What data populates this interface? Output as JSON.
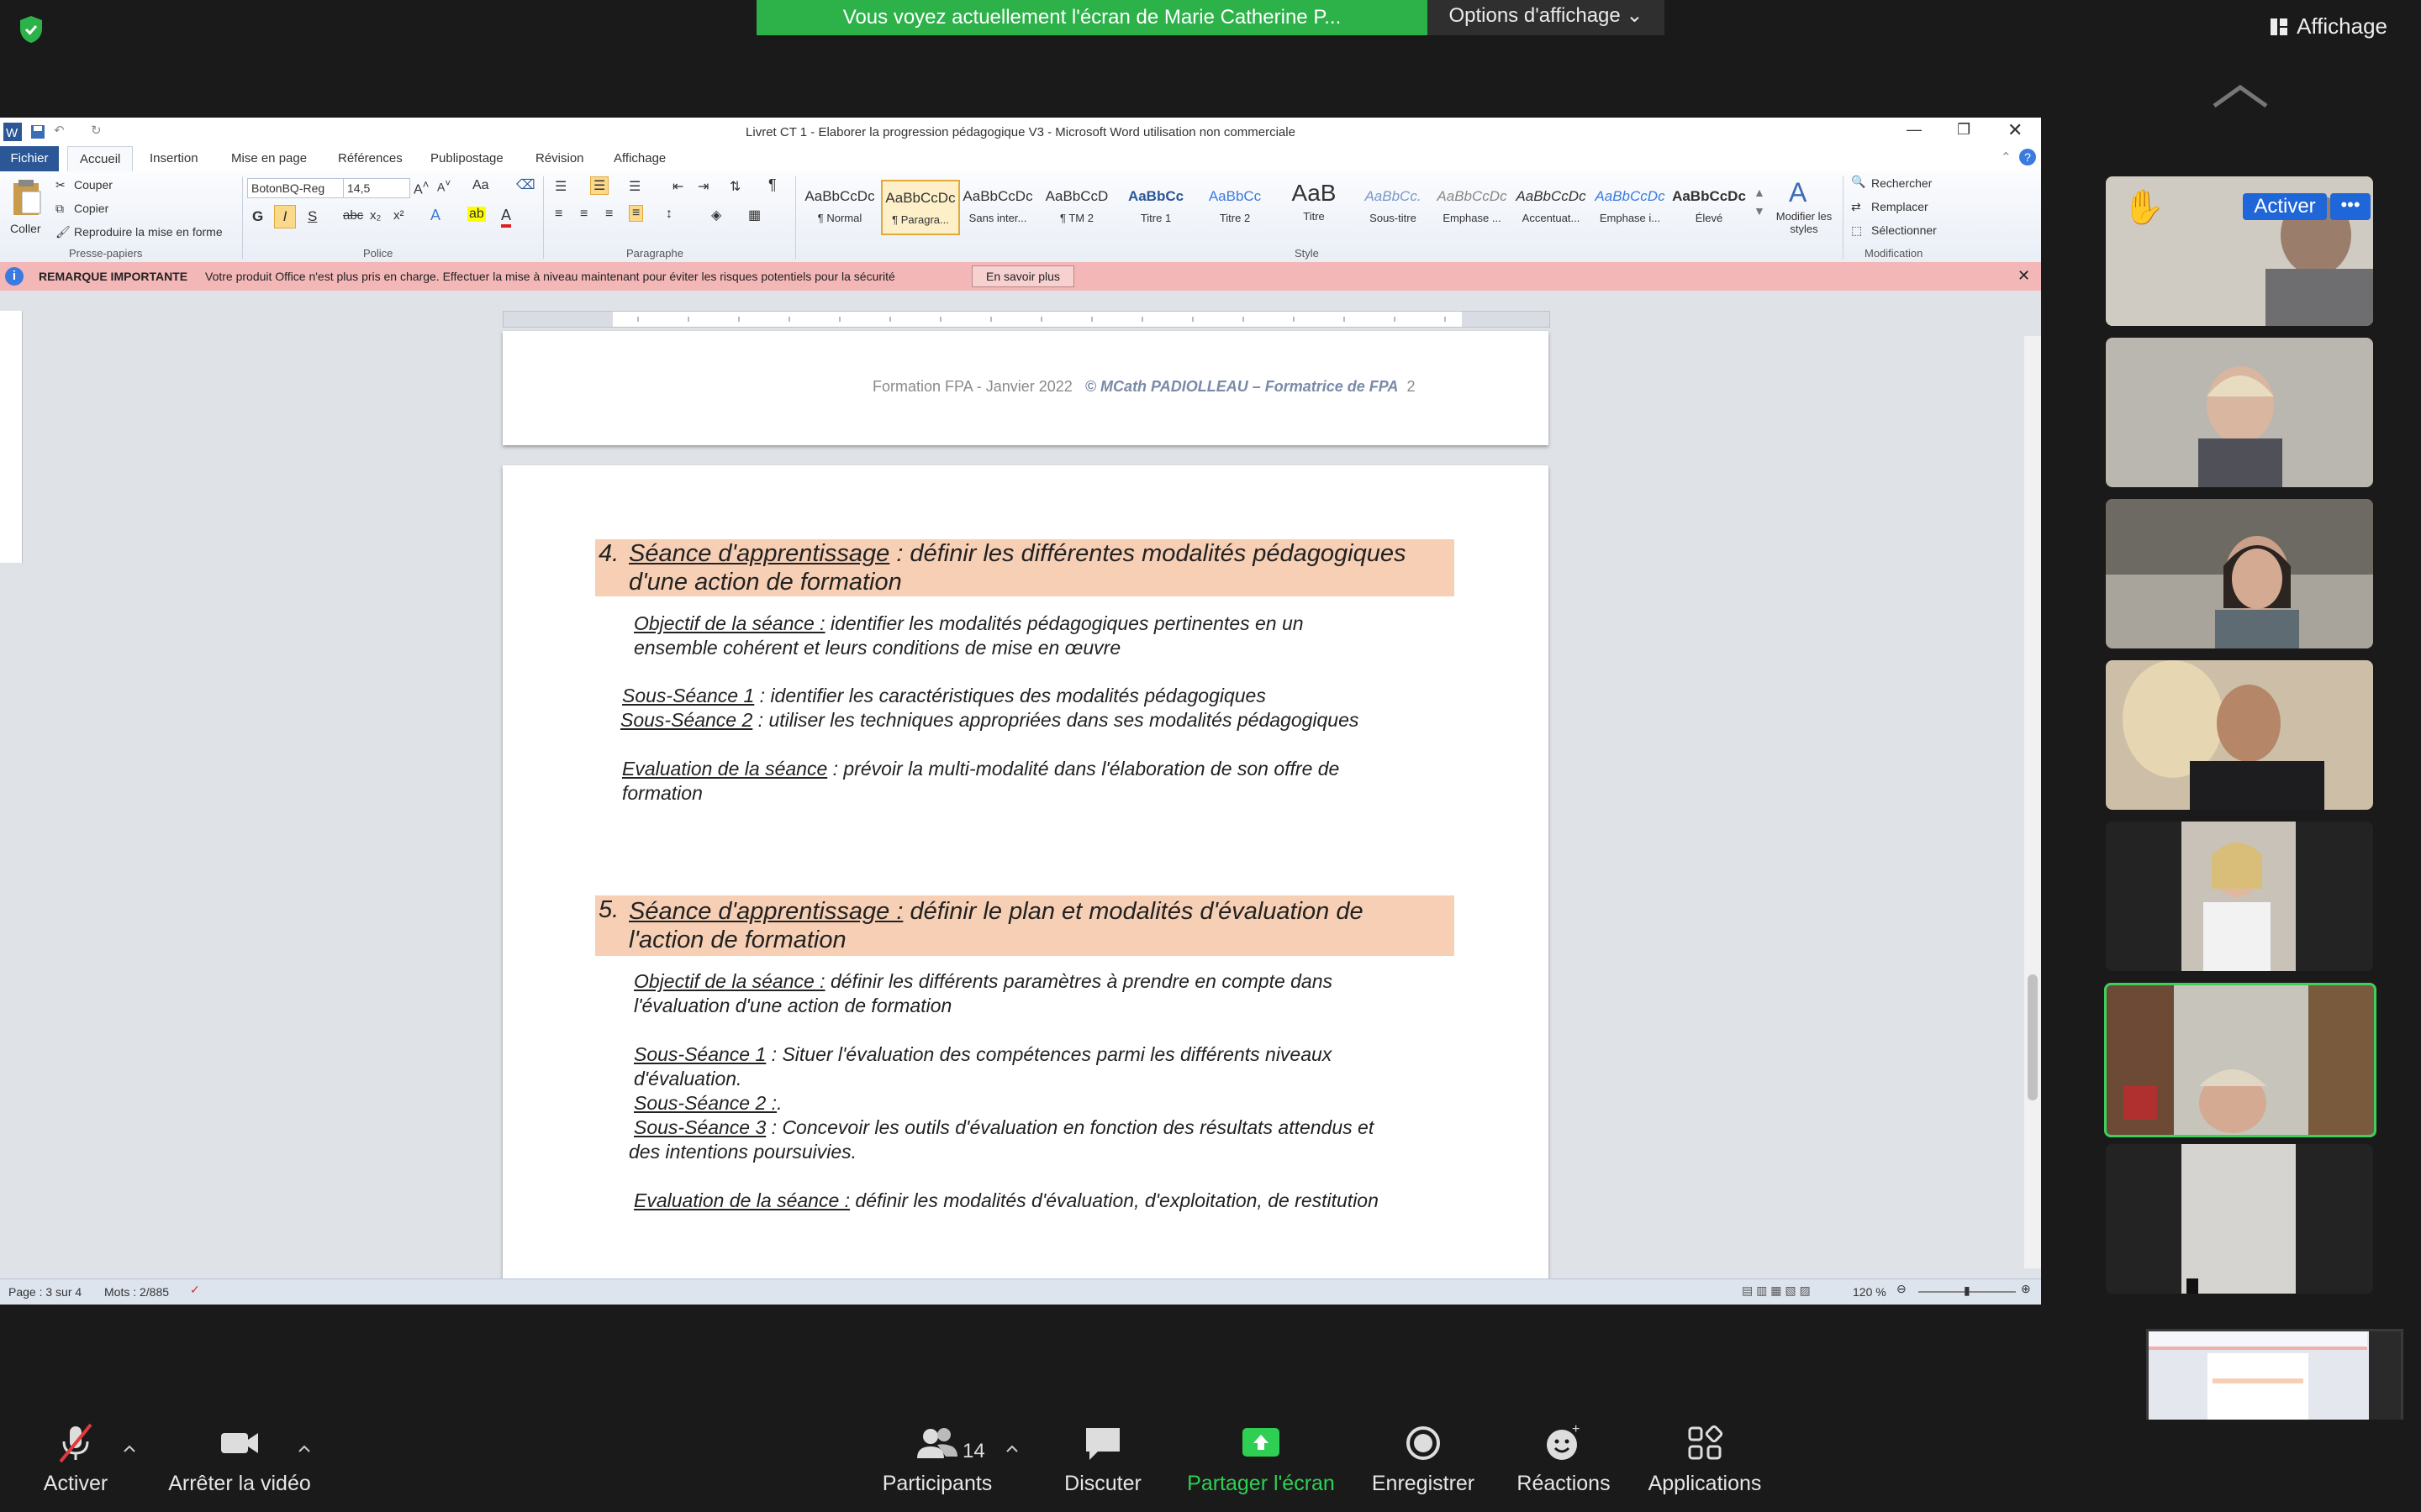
{
  "zoom_top": {
    "banner_text": "Vous voyez actuellement l'écran de Marie Catherine P...",
    "view_options": "Options d'affichage",
    "affichage": "Affichage"
  },
  "word": {
    "title": "Livret CT 1 - Elaborer la progression pédagogique V3 - Microsoft Word utilisation non commerciale",
    "tabs": [
      "Fichier",
      "Accueil",
      "Insertion",
      "Mise en page",
      "Références",
      "Publipostage",
      "Révision",
      "Affichage"
    ],
    "clipboard": {
      "paste": "Coller",
      "cut": "Couper",
      "copy": "Copier",
      "format_painter": "Reproduire la mise en forme",
      "group": "Presse-papiers"
    },
    "font": {
      "name": "BotonBQ-Reg",
      "size": "14,5",
      "group": "Police"
    },
    "paragraph_group": "Paragraphe",
    "styles": [
      {
        "sample": "AaBbCcDc",
        "label": "¶ Normal"
      },
      {
        "sample": "AaBbCcDc",
        "label": "¶ Paragra..."
      },
      {
        "sample": "AaBbCcDc",
        "label": "Sans inter..."
      },
      {
        "sample": "AaBbCcD",
        "label": "¶ TM 2"
      },
      {
        "sample": "AaBbCc",
        "label": "Titre 1"
      },
      {
        "sample": "AaBbCc",
        "label": "Titre 2"
      },
      {
        "sample": "AaB",
        "label": "Titre"
      },
      {
        "sample": "AaBbCc.",
        "label": "Sous-titre"
      },
      {
        "sample": "AaBbCcDc",
        "label": "Emphase ..."
      },
      {
        "sample": "AaBbCcDc",
        "label": "Accentuat..."
      },
      {
        "sample": "AaBbCcDc",
        "label": "Emphase i..."
      },
      {
        "sample": "AaBbCcDc",
        "label": "Élevé"
      }
    ],
    "style_group": "Style",
    "modify_styles": "Modifier les styles",
    "editing": {
      "find": "Rechercher",
      "replace": "Remplacer",
      "select": "Sélectionner",
      "group": "Modification"
    },
    "notice": {
      "title": "REMARQUE IMPORTANTE",
      "text": "Votre produit Office n'est plus pris en charge. Effectuer la mise à niveau maintenant pour éviter les risques potentiels pour la sécurité",
      "button": "En savoir plus"
    },
    "footer": {
      "text": "Formation FPA - Janvier 2022",
      "author": "© MCath PADIOLLEAU – Formatrice de FPA",
      "page": "2"
    },
    "sections": [
      {
        "num": "4.",
        "head_u": "Séance d'apprentissage",
        "head_rest": " : définir les différentes modalités pédagogiques",
        "head_line2": "d'une action de formation",
        "lines": [
          {
            "u": "Objectif de la séance :",
            "t": " identifier les modalités pédagogiques pertinentes en un"
          },
          {
            "u": "",
            "t": "ensemble cohérent et leurs conditions de mise en œuvre"
          },
          {
            "u": "Sous-Séance 1",
            "t": " : identifier les caractéristiques des modalités pédagogiques"
          },
          {
            "u": "Sous-Séance 2",
            "t": " : utiliser les techniques appropriées dans ses modalités pédagogiques"
          },
          {
            "u": "Evaluation de la séance",
            "t": " : prévoir la multi-modalité dans l'élaboration de son offre de"
          },
          {
            "u": "",
            "t": "formation"
          }
        ]
      },
      {
        "num": "5.",
        "head_u": "Séance d'apprentissage :",
        "head_rest": " définir le plan et modalités d'évaluation de",
        "head_line2": "l'action de formation",
        "lines": [
          {
            "u": "Objectif de la séance :",
            "t": " définir les différents paramètres à prendre en compte dans"
          },
          {
            "u": "",
            "t": "l'évaluation d'une action de formation"
          },
          {
            "u": "Sous-Séance 1",
            "t": " : Situer l'évaluation des compétences parmi les différents niveaux"
          },
          {
            "u": "",
            "t": "d'évaluation."
          },
          {
            "u": "Sous-Séance 2 :",
            "t": "."
          },
          {
            "u": "Sous-Séance 3",
            "t": " : Concevoir les outils d'évaluation en fonction des résultats attendus et"
          },
          {
            "u": "",
            "t": "des intentions poursuivies."
          },
          {
            "u": "Evaluation de la séance :",
            "t": " définir les modalités d'évaluation, d'exploitation, de restitution"
          }
        ]
      }
    ],
    "status": {
      "page": "Page : 3 sur 4",
      "words": "Mots : 2/885",
      "zoom": "120 %"
    }
  },
  "participants": {
    "activer": "Activer",
    "more": "•••"
  },
  "toolbar": {
    "mute": "Activer",
    "video": "Arrêter la vidéo",
    "participants": "Participants",
    "participants_count": "14",
    "chat": "Discuter",
    "share": "Partager l'écran",
    "record": "Enregistrer",
    "reactions": "Réactions",
    "apps": "Applications"
  },
  "colors": {
    "share_green": "#2db24a",
    "word_blue": "#2b5797",
    "heading_bg": "#f6cfb5",
    "notice_bg": "#f4b7b7"
  }
}
